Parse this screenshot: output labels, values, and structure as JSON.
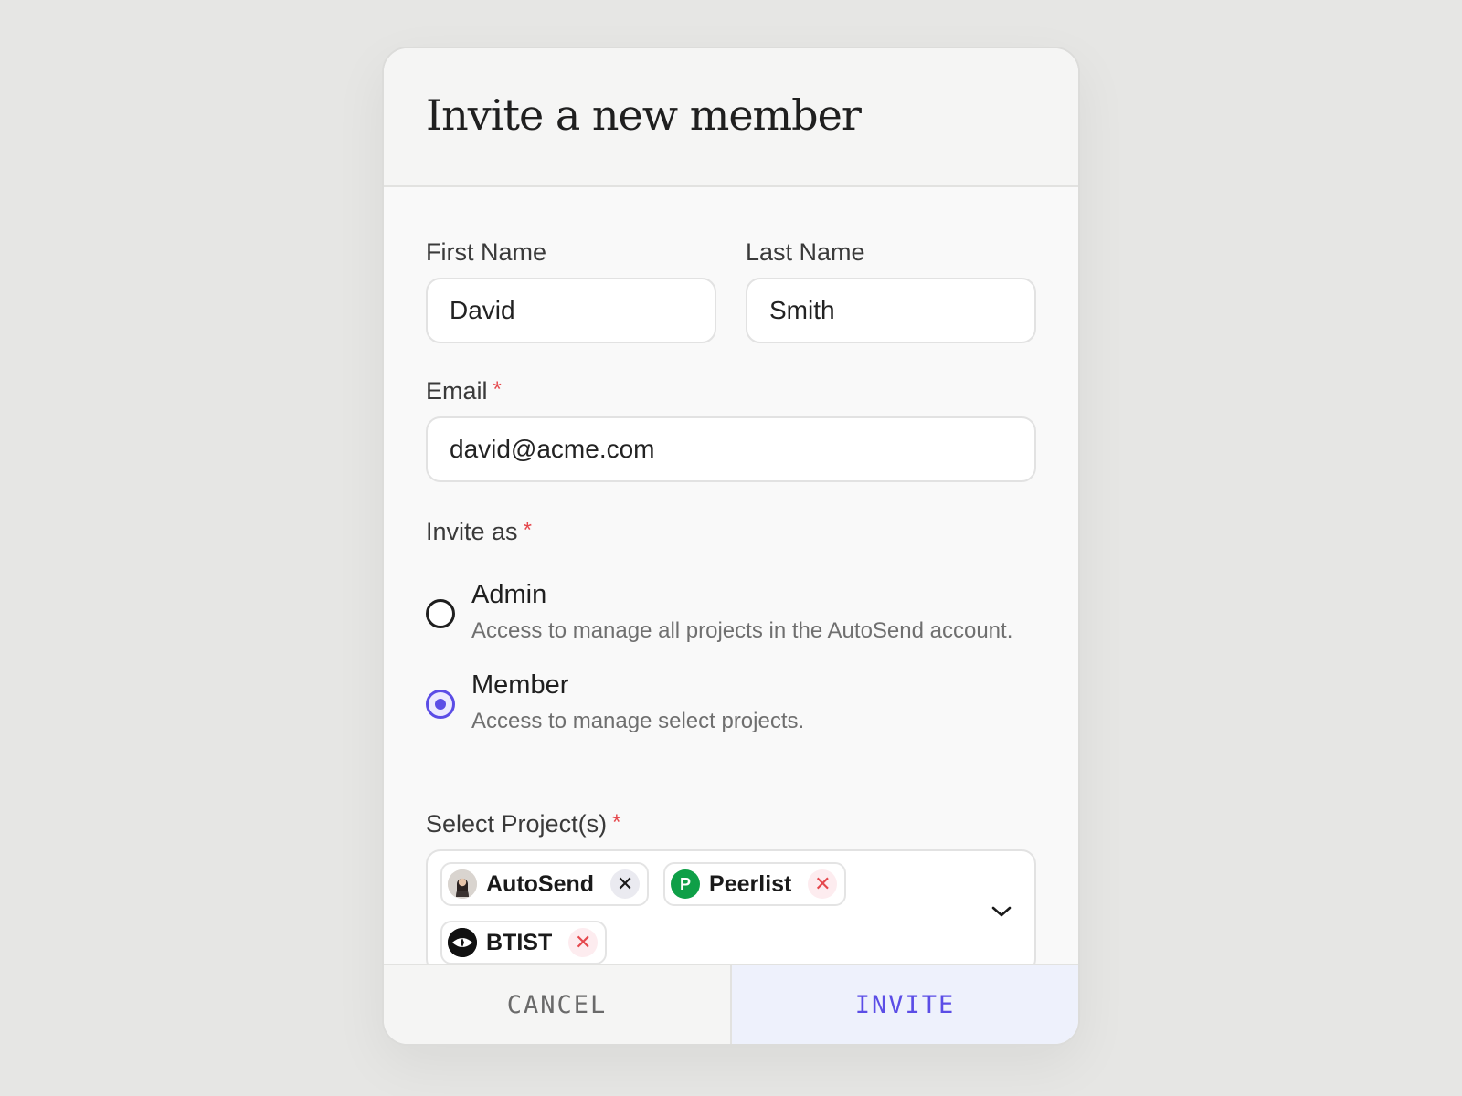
{
  "modal": {
    "title": "Invite a new member"
  },
  "form": {
    "first_name": {
      "label": "First Name",
      "value": "David"
    },
    "last_name": {
      "label": "Last Name",
      "value": "Smith"
    },
    "email": {
      "label": "Email",
      "required_mark": "*",
      "value": "david@acme.com"
    },
    "invite_as": {
      "label": "Invite as",
      "required_mark": "*",
      "selected": "Member",
      "options": [
        {
          "title": "Admin",
          "description": "Access to manage all projects in the AutoSend account.",
          "checked": false
        },
        {
          "title": "Member",
          "description": "Access to manage select projects.",
          "checked": true
        }
      ]
    },
    "projects": {
      "label": "Select Project(s)",
      "required_mark": "*",
      "selected": [
        {
          "name": "AutoSend",
          "icon": "avatar-icon"
        },
        {
          "name": "Peerlist",
          "icon": "peerlist-logo-icon",
          "logo_letter": "P"
        },
        {
          "name": "BTIST",
          "icon": "btist-logo-icon"
        }
      ],
      "remove_glyph": "✕"
    }
  },
  "footer": {
    "cancel_label": "CANCEL",
    "invite_label": "INVITE"
  },
  "colors": {
    "accent": "#5b4de6",
    "required": "#e5484d",
    "peerlist_green": "#0e9f47"
  }
}
